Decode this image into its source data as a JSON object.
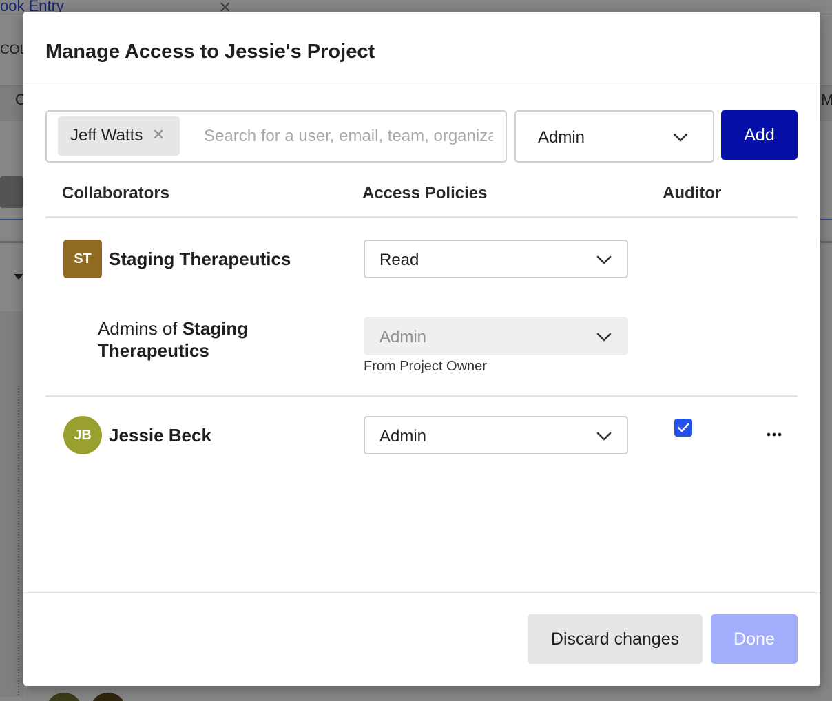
{
  "background": {
    "tab_label": "ook Entry",
    "column_label": "COL",
    "row_left_text": "C",
    "row_right_text": "M",
    "avatar_colors": [
      "#6b6f2a",
      "#5a4418"
    ]
  },
  "modal": {
    "title": "Manage Access to Jessie's Project",
    "add_row": {
      "chip_label": "Jeff Watts",
      "search_placeholder": "Search for a user, email, team, organization",
      "role_selected": "Admin",
      "add_label": "Add"
    },
    "table": {
      "headers": {
        "collaborators": "Collaborators",
        "access_policies": "Access Policies",
        "auditor": "Auditor"
      },
      "rows": [
        {
          "initials": "ST",
          "name": "Staging Therapeutics",
          "policy": "Read",
          "avatar_color": "#8e6a22",
          "sub": {
            "prefix": "Admins of",
            "org": "Staging Therapeutics",
            "policy": "Admin",
            "note": "From Project Owner"
          }
        },
        {
          "initials": "JB",
          "name": "Jessie Beck",
          "policy": "Admin",
          "avatar_color": "#9aa030",
          "auditor_checked": true,
          "more_icon": "ellipsis-icon"
        }
      ]
    },
    "footer": {
      "discard_label": "Discard changes",
      "done_label": "Done"
    }
  },
  "colors": {
    "primary_button": "#0610a8",
    "disabled_button": "#a2adfb",
    "checkbox": "#2452e8"
  }
}
